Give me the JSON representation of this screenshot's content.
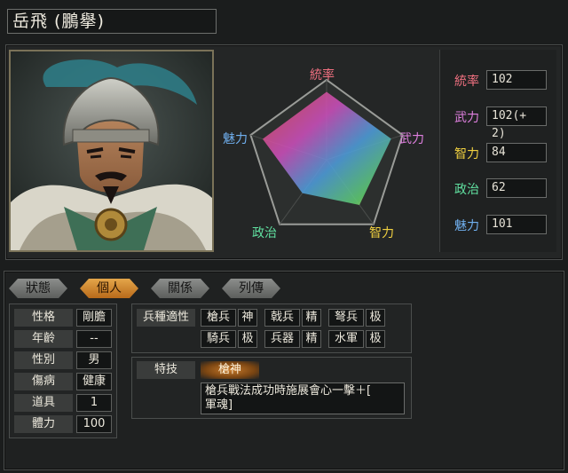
{
  "header": {
    "name": "岳飛 (鵬擧)"
  },
  "radar": {
    "labels": [
      "統率",
      "武力",
      "智力",
      "政治",
      "魅力"
    ],
    "label_colors": [
      "#f07080",
      "#e080e0",
      "#f0d040",
      "#60e0a0",
      "#70b0f0"
    ],
    "values": [
      102,
      102,
      84,
      62,
      101
    ]
  },
  "stats": [
    {
      "label": "統率",
      "value": "102",
      "color": "#f07080"
    },
    {
      "label": "武力",
      "value": "102(+ 2)",
      "color": "#e080e0"
    },
    {
      "label": "智力",
      "value": "84",
      "color": "#f0d040"
    },
    {
      "label": "政治",
      "value": "62",
      "color": "#60e0a0"
    },
    {
      "label": "魅力",
      "value": "101",
      "color": "#70b0f0"
    }
  ],
  "tabs": [
    "狀態",
    "個人",
    "關係",
    "列傳"
  ],
  "active_tab": "個人",
  "personal": [
    {
      "label": "性格",
      "value": "剛膽"
    },
    {
      "label": "年齡",
      "value": "--"
    },
    {
      "label": "性別",
      "value": "男"
    },
    {
      "label": "傷病",
      "value": "健康"
    },
    {
      "label": "道具",
      "value": "1"
    },
    {
      "label": "體力",
      "value": "100"
    }
  ],
  "aptitude": {
    "label": "兵種適性",
    "items": [
      {
        "unit": "槍兵",
        "rank": "神"
      },
      {
        "unit": "戟兵",
        "rank": "精"
      },
      {
        "unit": "弩兵",
        "rank": "极"
      },
      {
        "unit": "騎兵",
        "rank": "极"
      },
      {
        "unit": "兵器",
        "rank": "精"
      },
      {
        "unit": "水軍",
        "rank": "极"
      }
    ]
  },
  "skill": {
    "label": "特技",
    "name": "槍神",
    "desc_line1": "槍兵戰法成功時施展會心一擊＋[",
    "desc_line2": "軍魂]"
  }
}
